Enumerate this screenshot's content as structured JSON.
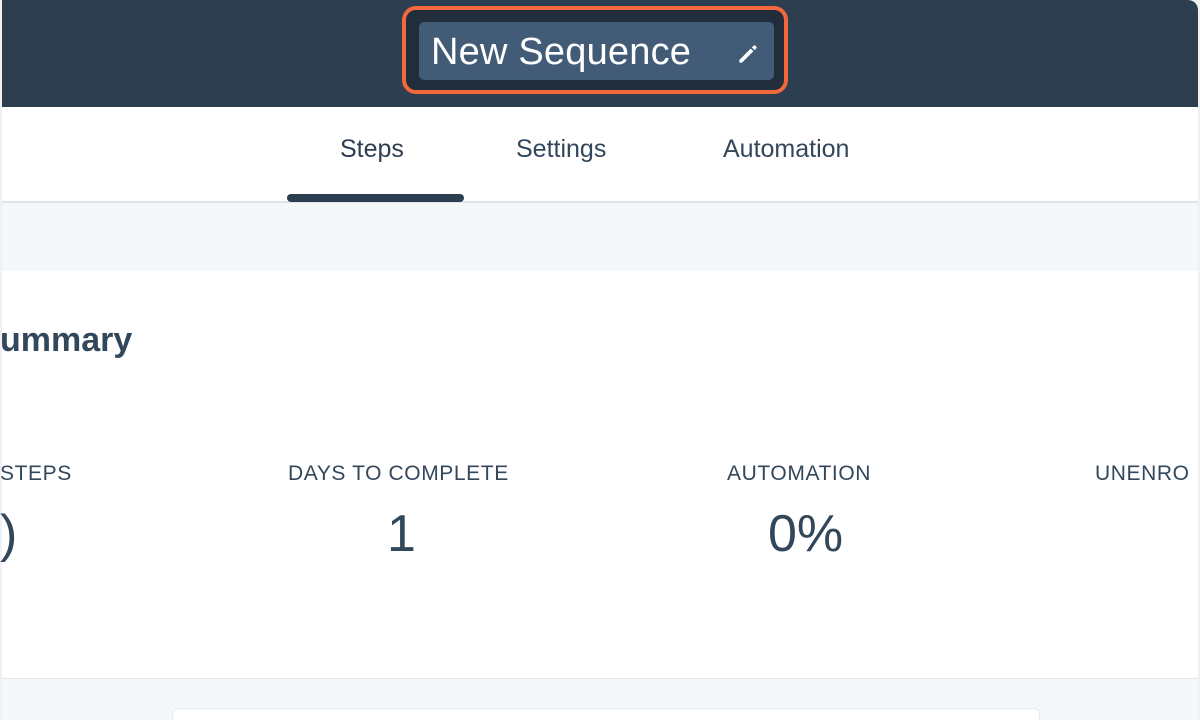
{
  "header": {
    "sequence_name": "New Sequence",
    "edit_icon": "pencil-icon"
  },
  "tabs": [
    {
      "label": "Steps",
      "active": true
    },
    {
      "label": "Settings",
      "active": false
    },
    {
      "label": "Automation",
      "active": false
    }
  ],
  "summary": {
    "title": "ummary",
    "stats": [
      {
        "label": "STEPS",
        "value": ")"
      },
      {
        "label": "DAYS TO COMPLETE",
        "value": "1"
      },
      {
        "label": "AUTOMATION",
        "value": "0%"
      },
      {
        "label": "UNENRO",
        "value": ""
      }
    ]
  },
  "colors": {
    "header_bg": "#2d3e50",
    "title_box_bg": "#425b76",
    "highlight": "#f2683c",
    "text": "#33475b"
  }
}
